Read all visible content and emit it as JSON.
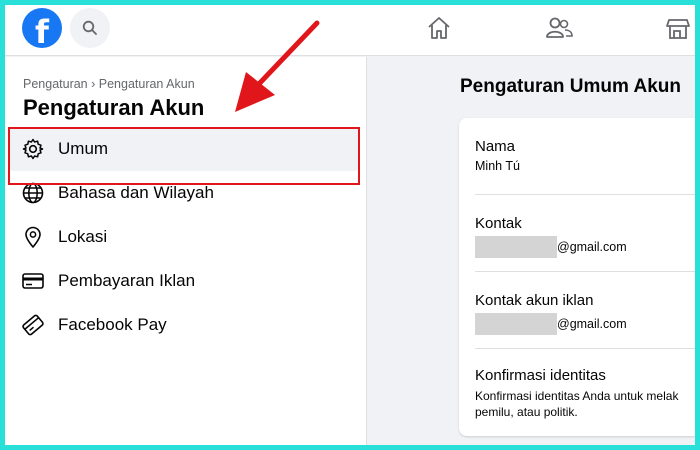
{
  "nav": {
    "logo_letter": "f",
    "icons": [
      "facebook-logo",
      "search-icon",
      "home-icon",
      "friends-icon",
      "marketplace-icon"
    ]
  },
  "sidebar": {
    "breadcrumb": "Pengaturan › Pengaturan Akun",
    "title": "Pengaturan Akun",
    "items": [
      {
        "label": "Umum",
        "icon": "gear-icon",
        "active": true
      },
      {
        "label": "Bahasa dan Wilayah",
        "icon": "globe-icon",
        "active": false
      },
      {
        "label": "Lokasi",
        "icon": "location-pin-icon",
        "active": false
      },
      {
        "label": "Pembayaran Iklan",
        "icon": "credit-card-icon",
        "active": false
      },
      {
        "label": "Facebook Pay",
        "icon": "payment-card-icon",
        "active": false
      }
    ]
  },
  "main": {
    "title": "Pengaturan Umum Akun",
    "rows": [
      {
        "label": "Nama",
        "value": "Minh Tú"
      },
      {
        "label": "Kontak",
        "value": "@gmail.com"
      },
      {
        "label": "Kontak akun iklan",
        "value": "@gmail.com"
      },
      {
        "label": "Konfirmasi identitas",
        "desc1": "Konfirmasi identitas Anda untuk melak",
        "desc2": "pemilu, atau politik."
      }
    ]
  },
  "colors": {
    "accent": "#1877f2",
    "highlight": "#e0161b",
    "frame": "#28e0d7"
  }
}
